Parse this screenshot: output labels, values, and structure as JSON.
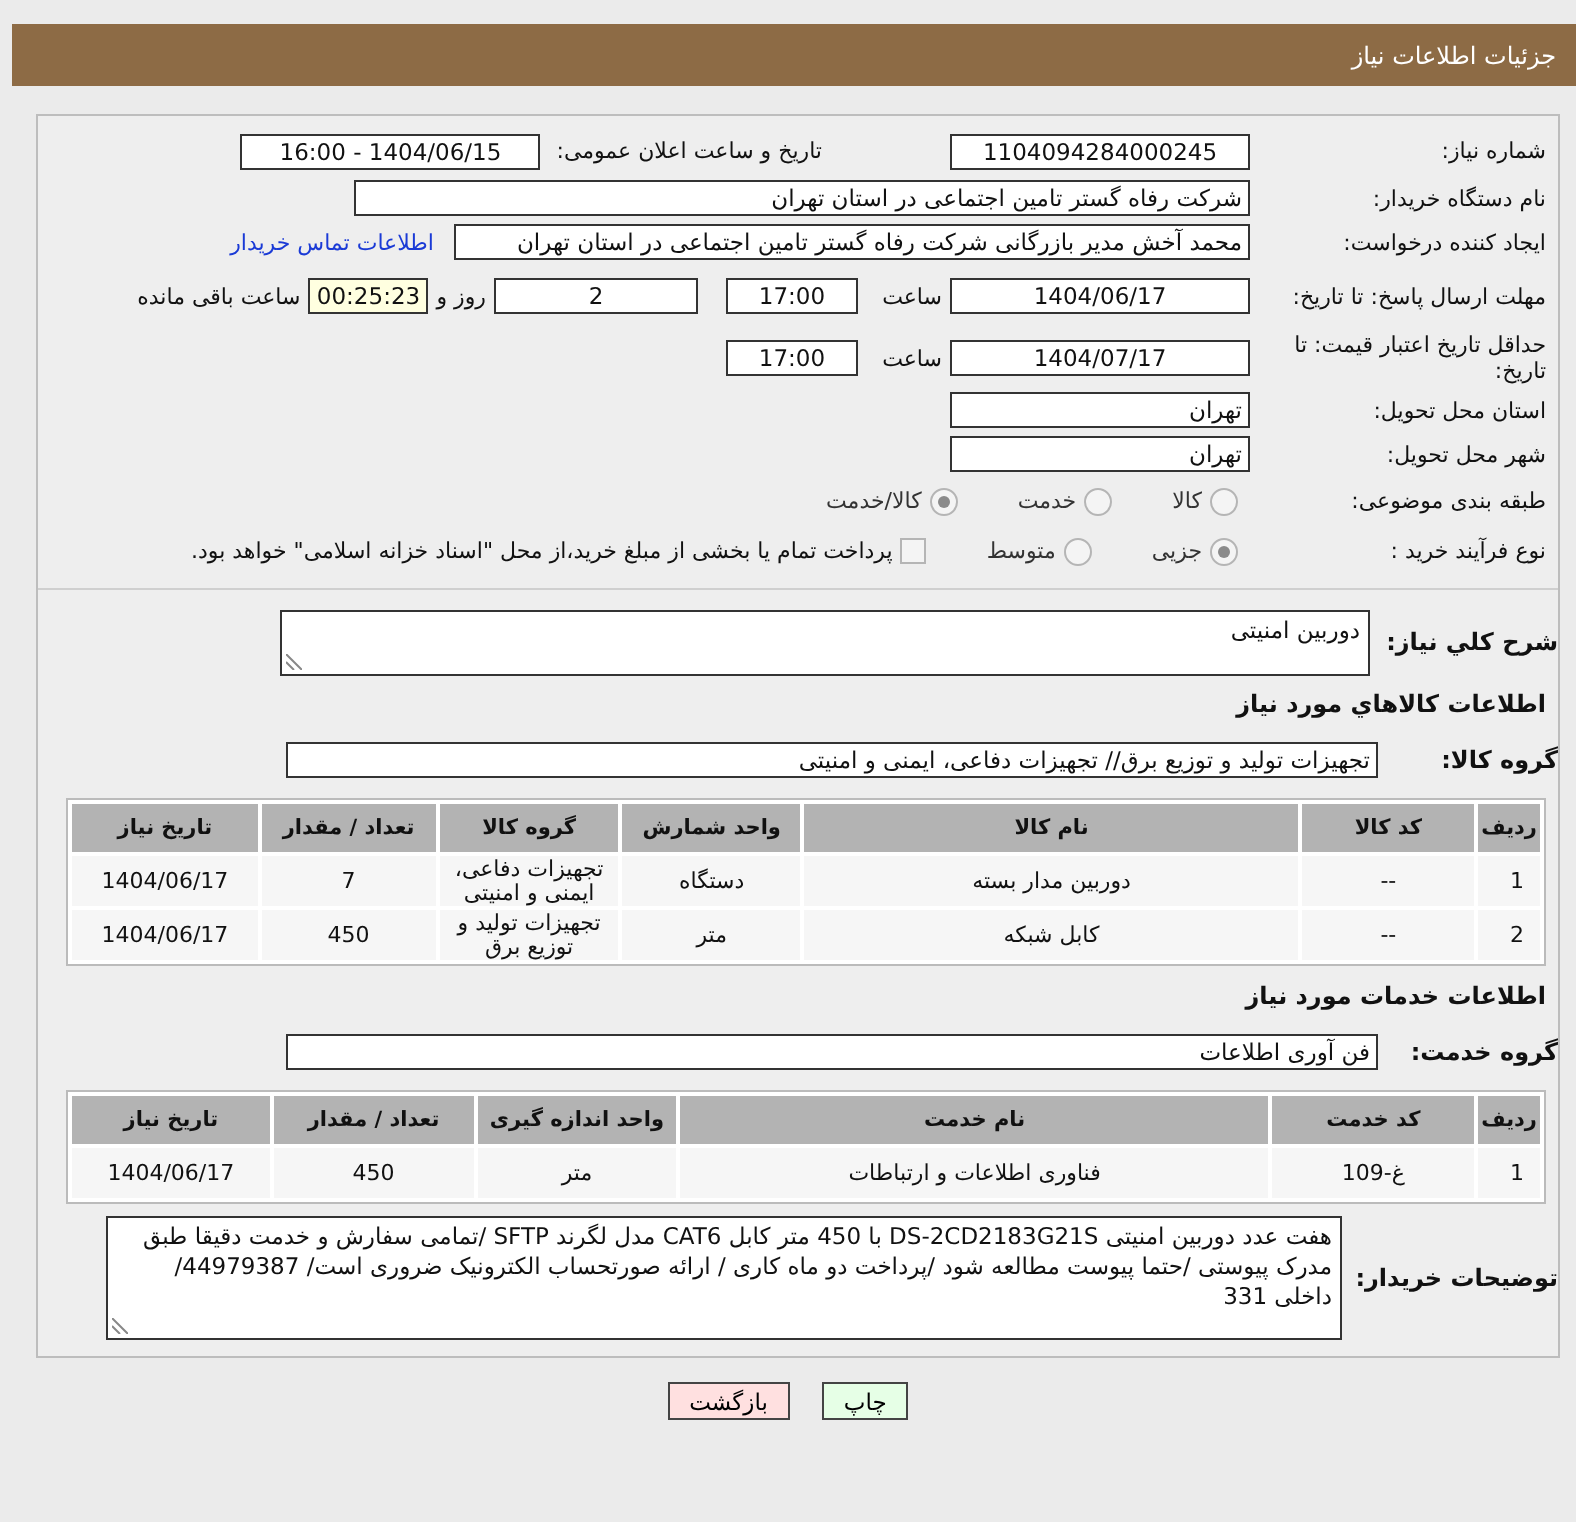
{
  "header": {
    "title": "جزئیات اطلاعات نیاز"
  },
  "need_number": {
    "label": "شماره نیاز:",
    "value": "1104094284000245"
  },
  "announce": {
    "label": "تاریخ و ساعت اعلان عمومی:",
    "value": "1404/06/15 - 16:00"
  },
  "buyer_org": {
    "label": "نام دستگاه خریدار:",
    "value": "شرکت رفاه گستر تامین اجتماعی در استان تهران"
  },
  "requester": {
    "label": "ایجاد کننده درخواست:",
    "value": "محمد آخش مدیر بازرگانی شرکت رفاه گستر تامین اجتماعی در استان تهران",
    "link": "اطلاعات تماس خریدار"
  },
  "deadline": {
    "label": "مهلت ارسال پاسخ: تا تاریخ:",
    "date": "1404/06/17",
    "time_label": "ساعت",
    "time": "17:00",
    "days": "2",
    "days_label": "روز و",
    "remaining": "00:25:23",
    "remaining_label": "ساعت باقی مانده"
  },
  "validity": {
    "label": "حداقل تاریخ اعتبار قیمت: تا تاریخ:",
    "date": "1404/07/17",
    "time_label": "ساعت",
    "time": "17:00"
  },
  "province": {
    "label": "استان محل تحویل:",
    "value": "تهران"
  },
  "city": {
    "label": "شهر محل تحویل:",
    "value": "تهران"
  },
  "category": {
    "label": "طبقه بندی موضوعی:",
    "options": [
      {
        "label": "کالا",
        "selected": false
      },
      {
        "label": "خدمت",
        "selected": false
      },
      {
        "label": "کالا/خدمت",
        "selected": true
      }
    ]
  },
  "process": {
    "label": "نوع فرآیند خرید :",
    "options": [
      {
        "label": "جزیی",
        "selected": true
      },
      {
        "label": "متوسط",
        "selected": false
      }
    ],
    "checkbox": {
      "label": "پرداخت تمام یا بخشی از مبلغ خرید،از محل \"اسناد خزانه اسلامی\" خواهد بود.",
      "checked": false
    }
  },
  "description": {
    "label": "شرح کلي نیاز:",
    "value": "دوربین امنیتی"
  },
  "goods": {
    "title": "اطلاعات کالاهاي مورد نیاز",
    "group_label": "گروه کالا:",
    "group_value": "تجهیزات تولید و توزیع برق// تجهیزات دفاعی، ایمنی و امنیتی",
    "columns": [
      "ردیف",
      "کد کالا",
      "نام کالا",
      "واحد شمارش",
      "گروه کالا",
      "تعداد / مقدار",
      "تاریخ نیاز"
    ],
    "rows": [
      [
        "1",
        "--",
        "دوربین مدار بسته",
        "دستگاه",
        "تجهیزات دفاعی، ایمنی و امنیتی",
        "7",
        "1404/06/17"
      ],
      [
        "2",
        "--",
        "کابل شبکه",
        "متر",
        "تجهیزات تولید و توزیع برق",
        "450",
        "1404/06/17"
      ]
    ]
  },
  "services": {
    "title": "اطلاعات خدمات مورد نیاز",
    "group_label": "گروه خدمت:",
    "group_value": "فن آوری اطلاعات",
    "columns": [
      "ردیف",
      "کد خدمت",
      "نام خدمت",
      "واحد اندازه گیری",
      "تعداد / مقدار",
      "تاریخ نیاز"
    ],
    "rows": [
      [
        "1",
        "غ-109",
        "فناوری اطلاعات و ارتباطات",
        "متر",
        "450",
        "1404/06/17"
      ]
    ]
  },
  "buyer_notes": {
    "label": "توضیحات خریدار:",
    "value": "هفت عدد دوربین امنیتی  DS-2CD2183G21S  با 450 متر کابل CAT6 مدل لگرند SFTP /تمامی سفارش و خدمت دقیقا طبق مدرک پیوستی /حتما پیوست مطالعه شود /پرداخت دو ماه کاری / ارائه صورتحساب الکترونیک ضروری است/ 44979387/ داخلی 331"
  },
  "buttons": [
    {
      "label": "چاپ",
      "kind": "print"
    },
    {
      "label": "بازگشت",
      "kind": "back"
    }
  ]
}
